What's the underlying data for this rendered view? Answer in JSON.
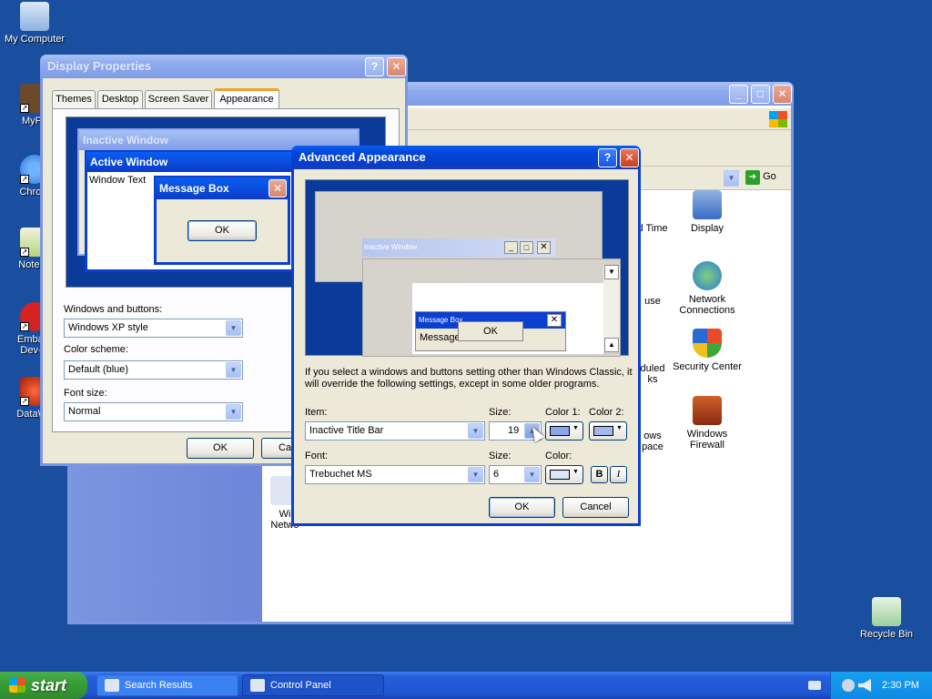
{
  "desktop": {
    "icons": [
      {
        "label": "My Computer"
      },
      {
        "label": "MyPa"
      },
      {
        "label": "Chrom"
      },
      {
        "label": "Notepa"
      },
      {
        "label": "Embarc Dev-C"
      },
      {
        "label": "DataWa"
      },
      {
        "label": "Recycle Bin"
      }
    ]
  },
  "control_panel": {
    "address_go": "Go",
    "items": [
      {
        "label": "d Time"
      },
      {
        "label": "Display"
      },
      {
        "label": "use"
      },
      {
        "label": "Network Connections"
      },
      {
        "label": "duled ks"
      },
      {
        "label": "Security Center"
      },
      {
        "label": "ows pace"
      },
      {
        "label": "Windows Firewall"
      },
      {
        "label": "Wi Netwo"
      }
    ]
  },
  "display_properties": {
    "title": "Display Properties",
    "tabs": [
      "Themes",
      "Desktop",
      "Screen Saver",
      "Appearance"
    ],
    "active_tab": "Appearance",
    "preview": {
      "inactive_title": "Inactive Window",
      "active_title": "Active Window",
      "window_text": "Window Text",
      "message_box_title": "Message Box",
      "ok": "OK"
    },
    "windows_buttons_label": "Windows and buttons:",
    "windows_buttons_value": "Windows XP style",
    "color_scheme_label": "Color scheme:",
    "color_scheme_value": "Default (blue)",
    "font_size_label": "Font size:",
    "font_size_value": "Normal",
    "ok": "OK",
    "cancel": "Ca"
  },
  "advanced": {
    "title": "Advanced Appearance",
    "preview": {
      "inactive_title": "Inactive Window",
      "message_box_title": "Message Box",
      "message_text": "Message",
      "ok": "OK"
    },
    "info_text": "If you select a windows and buttons setting other than Windows Classic, it will override the following settings, except in some older programs.",
    "item_label": "Item:",
    "item_value": "Inactive Title Bar",
    "size_label": "Size:",
    "size_value": "19",
    "color1_label": "Color 1:",
    "color2_label": "Color 2:",
    "font_label": "Font:",
    "font_value": "Trebuchet MS",
    "font_size_label": "Size:",
    "font_size_value": "6",
    "color_label": "Color:",
    "bold": "B",
    "italic": "I",
    "ok": "OK",
    "cancel": "Cancel"
  },
  "taskbar": {
    "start": "start",
    "items": [
      "Search Results",
      "Control Panel"
    ],
    "clock": "2:30 PM"
  },
  "colors": {
    "desktop": "#1a4fa0",
    "title_active": "#0a3fd0",
    "title_inactive": "#7b97e0",
    "color1_swatch": "#8aa6e6",
    "color2_swatch": "#a3b9ee",
    "font_color_swatch": "#dce6fa"
  }
}
